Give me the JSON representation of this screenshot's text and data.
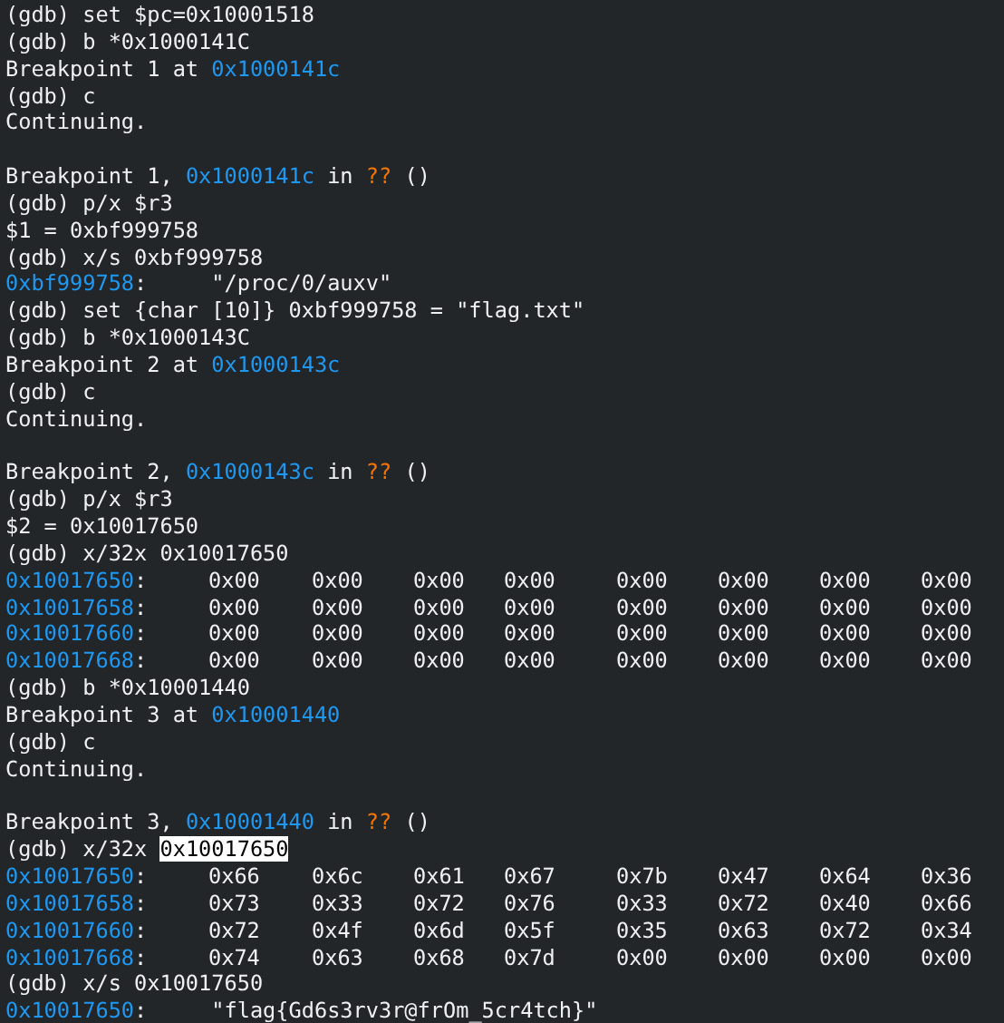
{
  "terminal": {
    "lines": [
      {
        "kind": "text",
        "segments": [
          {
            "text": "(gdb) set $pc=0x10001518",
            "color": "#eff0f1"
          }
        ]
      },
      {
        "kind": "text",
        "segments": [
          {
            "text": "(gdb) b *0x1000141C",
            "color": "#eff0f1"
          }
        ]
      },
      {
        "kind": "text",
        "segments": [
          {
            "text": "Breakpoint 1 at ",
            "color": "#eff0f1"
          },
          {
            "text": "0x1000141c",
            "color": "#1d99f3"
          }
        ]
      },
      {
        "kind": "text",
        "segments": [
          {
            "text": "(gdb) c",
            "color": "#eff0f1"
          }
        ]
      },
      {
        "kind": "text",
        "segments": [
          {
            "text": "Continuing.",
            "color": "#eff0f1"
          }
        ]
      },
      {
        "kind": "blank"
      },
      {
        "kind": "text",
        "segments": [
          {
            "text": "Breakpoint 1, ",
            "color": "#eff0f1"
          },
          {
            "text": "0x1000141c",
            "color": "#1d99f3"
          },
          {
            "text": " in ",
            "color": "#eff0f1"
          },
          {
            "text": "??",
            "color": "#f67400"
          },
          {
            "text": " ()",
            "color": "#eff0f1"
          }
        ]
      },
      {
        "kind": "text",
        "segments": [
          {
            "text": "(gdb) p/x $r3",
            "color": "#eff0f1"
          }
        ]
      },
      {
        "kind": "text",
        "segments": [
          {
            "text": "$1 = 0xbf999758",
            "color": "#eff0f1"
          }
        ]
      },
      {
        "kind": "text",
        "segments": [
          {
            "text": "(gdb) x/s 0xbf999758",
            "color": "#eff0f1"
          }
        ]
      },
      {
        "kind": "text",
        "segments": [
          {
            "text": "0xbf999758",
            "color": "#1d99f3"
          },
          {
            "text": ":     \"/proc/0/auxv\"",
            "color": "#eff0f1"
          }
        ]
      },
      {
        "kind": "text",
        "segments": [
          {
            "text": "(gdb) set {char [10]} 0xbf999758 = \"flag.txt\"",
            "color": "#eff0f1"
          }
        ]
      },
      {
        "kind": "text",
        "segments": [
          {
            "text": "(gdb) b *0x1000143C",
            "color": "#eff0f1"
          }
        ]
      },
      {
        "kind": "text",
        "segments": [
          {
            "text": "Breakpoint 2 at ",
            "color": "#eff0f1"
          },
          {
            "text": "0x1000143c",
            "color": "#1d99f3"
          }
        ]
      },
      {
        "kind": "text",
        "segments": [
          {
            "text": "(gdb) c",
            "color": "#eff0f1"
          }
        ]
      },
      {
        "kind": "text",
        "segments": [
          {
            "text": "Continuing.",
            "color": "#eff0f1"
          }
        ]
      },
      {
        "kind": "blank"
      },
      {
        "kind": "text",
        "segments": [
          {
            "text": "Breakpoint 2, ",
            "color": "#eff0f1"
          },
          {
            "text": "0x1000143c",
            "color": "#1d99f3"
          },
          {
            "text": " in ",
            "color": "#eff0f1"
          },
          {
            "text": "??",
            "color": "#f67400"
          },
          {
            "text": " ()",
            "color": "#eff0f1"
          }
        ]
      },
      {
        "kind": "text",
        "segments": [
          {
            "text": "(gdb) p/x $r3",
            "color": "#eff0f1"
          }
        ]
      },
      {
        "kind": "text",
        "segments": [
          {
            "text": "$2 = 0x10017650",
            "color": "#eff0f1"
          }
        ]
      },
      {
        "kind": "text",
        "segments": [
          {
            "text": "(gdb) x/32x 0x10017650",
            "color": "#eff0f1"
          }
        ]
      },
      {
        "kind": "dump",
        "address": [
          {
            "text": "0x10017650",
            "color": "#1d99f3"
          },
          {
            "text": ":",
            "color": "#eff0f1"
          }
        ],
        "values": [
          "0x00",
          "0x00",
          "0x00",
          "0x00",
          "0x00",
          "0x00",
          "0x00",
          "0x00"
        ]
      },
      {
        "kind": "dump",
        "address": [
          {
            "text": "0x10017658",
            "color": "#1d99f3"
          },
          {
            "text": ":",
            "color": "#eff0f1"
          }
        ],
        "values": [
          "0x00",
          "0x00",
          "0x00",
          "0x00",
          "0x00",
          "0x00",
          "0x00",
          "0x00"
        ]
      },
      {
        "kind": "dump",
        "address": [
          {
            "text": "0x10017660",
            "color": "#1d99f3"
          },
          {
            "text": ":",
            "color": "#eff0f1"
          }
        ],
        "values": [
          "0x00",
          "0x00",
          "0x00",
          "0x00",
          "0x00",
          "0x00",
          "0x00",
          "0x00"
        ]
      },
      {
        "kind": "dump",
        "address": [
          {
            "text": "0x10017668",
            "color": "#1d99f3"
          },
          {
            "text": ":",
            "color": "#eff0f1"
          }
        ],
        "values": [
          "0x00",
          "0x00",
          "0x00",
          "0x00",
          "0x00",
          "0x00",
          "0x00",
          "0x00"
        ]
      },
      {
        "kind": "text",
        "segments": [
          {
            "text": "(gdb) b *0x10001440",
            "color": "#eff0f1"
          }
        ]
      },
      {
        "kind": "text",
        "segments": [
          {
            "text": "Breakpoint 3 at ",
            "color": "#eff0f1"
          },
          {
            "text": "0x10001440",
            "color": "#1d99f3"
          }
        ]
      },
      {
        "kind": "text",
        "segments": [
          {
            "text": "(gdb) c",
            "color": "#eff0f1"
          }
        ]
      },
      {
        "kind": "text",
        "segments": [
          {
            "text": "Continuing.",
            "color": "#eff0f1"
          }
        ]
      },
      {
        "kind": "blank"
      },
      {
        "kind": "text",
        "segments": [
          {
            "text": "Breakpoint 3, ",
            "color": "#eff0f1"
          },
          {
            "text": "0x10001440",
            "color": "#1d99f3"
          },
          {
            "text": " in ",
            "color": "#eff0f1"
          },
          {
            "text": "??",
            "color": "#f67400"
          },
          {
            "text": " ()",
            "color": "#eff0f1"
          }
        ]
      },
      {
        "kind": "text",
        "segments": [
          {
            "text": "(gdb) x/32x ",
            "color": "#eff0f1",
            "selected": false
          },
          {
            "text": "0x10017650",
            "color": "#000000",
            "selected": true
          }
        ]
      },
      {
        "kind": "dump",
        "address": [
          {
            "text": "0x10017650",
            "color": "#1d99f3"
          },
          {
            "text": ":",
            "color": "#eff0f1"
          }
        ],
        "values": [
          "0x66",
          "0x6c",
          "0x61",
          "0x67",
          "0x7b",
          "0x47",
          "0x64",
          "0x36"
        ]
      },
      {
        "kind": "dump",
        "address": [
          {
            "text": "0x10017658",
            "color": "#1d99f3"
          },
          {
            "text": ":",
            "color": "#eff0f1"
          }
        ],
        "values": [
          "0x73",
          "0x33",
          "0x72",
          "0x76",
          "0x33",
          "0x72",
          "0x40",
          "0x66"
        ]
      },
      {
        "kind": "dump",
        "address": [
          {
            "text": "0x10017660",
            "color": "#1d99f3"
          },
          {
            "text": ":",
            "color": "#eff0f1"
          }
        ],
        "values": [
          "0x72",
          "0x4f",
          "0x6d",
          "0x5f",
          "0x35",
          "0x63",
          "0x72",
          "0x34"
        ]
      },
      {
        "kind": "dump",
        "address": [
          {
            "text": "0x10017668",
            "color": "#1d99f3"
          },
          {
            "text": ":",
            "color": "#eff0f1"
          }
        ],
        "values": [
          "0x74",
          "0x63",
          "0x68",
          "0x7d",
          "0x00",
          "0x00",
          "0x00",
          "0x00"
        ]
      },
      {
        "kind": "text",
        "segments": [
          {
            "text": "(gdb) x/s 0x10017650",
            "color": "#eff0f1"
          }
        ]
      },
      {
        "kind": "text",
        "segments": [
          {
            "text": "0x10017650",
            "color": "#1d99f3"
          },
          {
            "text": ":     \"flag{Gd6s3rv3r@frOm_5cr4tch}\"",
            "color": "#eff0f1"
          }
        ]
      }
    ]
  }
}
